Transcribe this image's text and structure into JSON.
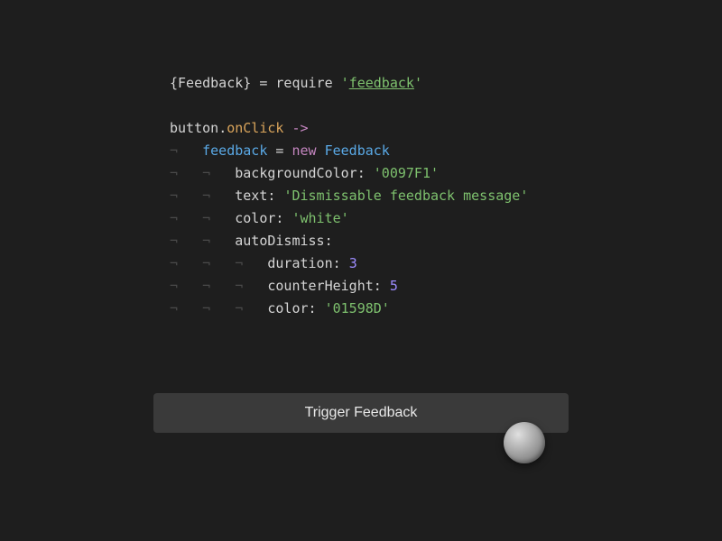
{
  "code": {
    "line1": {
      "brace_open": "{",
      "feedback_var": "Feedback",
      "brace_close": "}",
      "op": " = ",
      "require": "require ",
      "string_q1": "'",
      "string_val": "feedback",
      "string_q2": "'"
    },
    "line3": {
      "button": "button",
      "dot": ".",
      "onclick": "onClick",
      "arrow": " ->"
    },
    "line4": {
      "feedback": "feedback",
      "op": " = ",
      "new": "new",
      "sp": " ",
      "class": "Feedback"
    },
    "line5": {
      "prop": "backgroundColor",
      "colon": ": ",
      "val": "'0097F1'"
    },
    "line6": {
      "prop": "text",
      "colon": ": ",
      "val": "'Dismissable feedback message'"
    },
    "line7": {
      "prop": "color",
      "colon": ": ",
      "val": "'white'"
    },
    "line8": {
      "prop": "autoDismiss",
      "colon": ":"
    },
    "line9": {
      "prop": "duration",
      "colon": ": ",
      "val": "3"
    },
    "line10": {
      "prop": "counterHeight",
      "colon": ": ",
      "val": "5"
    },
    "line11": {
      "prop": "color",
      "colon": ": ",
      "val": "'01598D'"
    }
  },
  "button": {
    "label": "Trigger Feedback"
  },
  "ws": {
    "i1": "¬   ",
    "i2": "¬   ¬   ",
    "i3": "¬   ¬   ¬   "
  }
}
